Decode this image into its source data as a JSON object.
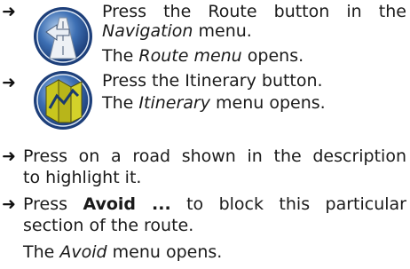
{
  "steps_icons": [
    {
      "icon": "route-button-icon",
      "line1": "Press the Route button in the",
      "line2_italic": "Navigation",
      "line2_rest": " menu.",
      "line3_pre": "The ",
      "line3_italic": "Route menu",
      "line3_post": " opens."
    },
    {
      "icon": "itinerary-button-icon",
      "line1": "Press the Itinerary button.",
      "line2_pre": "The ",
      "line2_italic": "Itinerary",
      "line2_post": " menu opens."
    }
  ],
  "steps": [
    {
      "line1": "Press on a road shown in the description",
      "line2": "to highlight it."
    },
    {
      "line1_pre": "Press ",
      "line1_bold": "Avoid ...",
      "line1_post": " to block this particular",
      "line2": "section of the route."
    }
  ],
  "result": {
    "pre": "The ",
    "italic": "Avoid",
    "post": " menu opens."
  },
  "arrow_glyph": "➜",
  "colors": {
    "icon_outer": "#1d3f7a",
    "icon_inner": "#3d6fb3",
    "icon_light": "#b7d2f0",
    "road": "#f2f2f2",
    "sign_yellow": "#c8c61e"
  }
}
